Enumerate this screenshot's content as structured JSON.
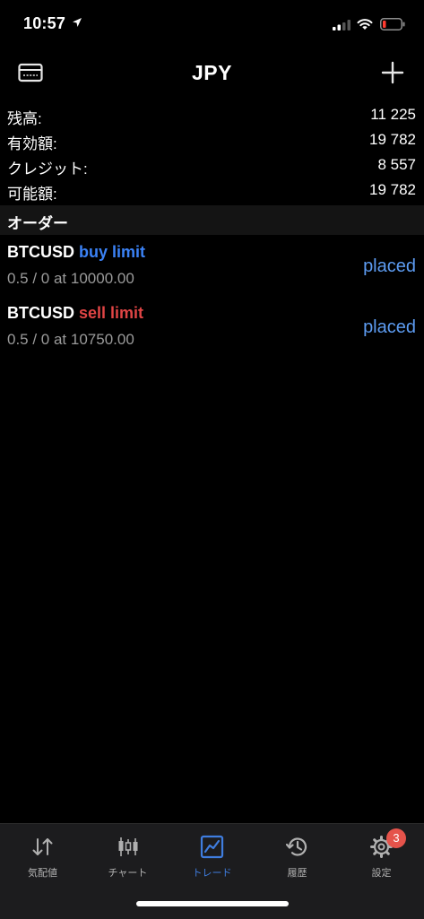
{
  "status_bar": {
    "time": "10:57"
  },
  "nav": {
    "title": "JPY",
    "left_icon": "account-card-icon",
    "right_icon": "plus-icon"
  },
  "summary": [
    {
      "label": "残高:",
      "value": "11 225"
    },
    {
      "label": "有効額:",
      "value": "19 782"
    },
    {
      "label": "クレジット:",
      "value": "8 557"
    },
    {
      "label": "可能額:",
      "value": "19 782"
    }
  ],
  "orders_section": {
    "title": "オーダー"
  },
  "orders": [
    {
      "symbol": "BTCUSD",
      "type": "buy limit",
      "detail": "0.5 / 0 at 10000.00",
      "status": "placed"
    },
    {
      "symbol": "BTCUSD",
      "type": "sell limit",
      "detail": "0.5 / 0 at 10750.00",
      "status": "placed"
    }
  ],
  "tabbar": {
    "tabs": [
      {
        "label": "気配値",
        "icon": "arrows-updown-icon"
      },
      {
        "label": "チャート",
        "icon": "candlestick-icon"
      },
      {
        "label": "トレード",
        "icon": "trade-chart-icon",
        "active": true
      },
      {
        "label": "履歴",
        "icon": "history-icon"
      },
      {
        "label": "設定",
        "icon": "gear-icon",
        "badge": "3"
      }
    ]
  },
  "colors": {
    "buy": "#3b82f6",
    "sell": "#e04545",
    "status": "#5d9cf2",
    "active_tab": "#3f7ddf",
    "badge": "#e5534b"
  }
}
